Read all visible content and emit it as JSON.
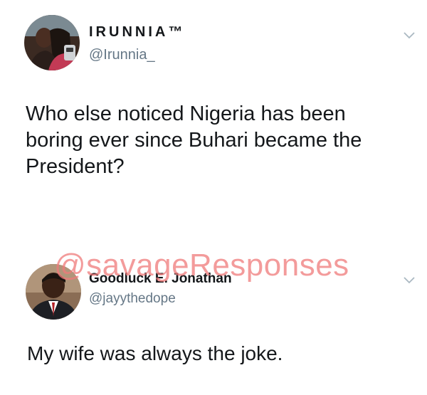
{
  "tweets": [
    {
      "display_name": "IRUNNIA™",
      "handle": "@Irunnia_",
      "text_lines": [
        "Who else noticed Nigeria has been",
        "boring ever since Buhari became the",
        "President?"
      ],
      "menu_icon": "chevron-down-icon"
    },
    {
      "display_name": "Goodluck E. Jonathan",
      "handle": "@jayythedope",
      "text_lines": [
        "My wife was always the joke."
      ],
      "menu_icon": "chevron-down-icon"
    }
  ],
  "watermark": "@savageResponses",
  "colors": {
    "text": "#14171a",
    "handle": "#657786",
    "chevron": "#aab8c2",
    "watermark": "#f07a7a"
  }
}
